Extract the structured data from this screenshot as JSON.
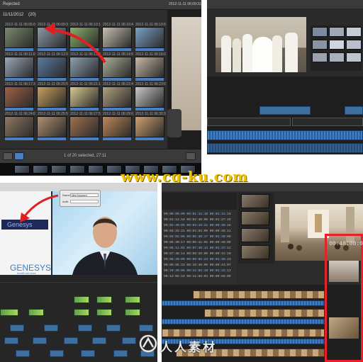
{
  "watermark": {
    "text": "www.cg-ku.com"
  },
  "logo_watermark": {
    "text": "人人素材"
  },
  "panel_a": {
    "header_left": "Rejected",
    "header_right": "2012-11-11 06:09:31",
    "event_label": "11/11/2012",
    "event_count": "(20)",
    "footer_text": "1 of 20 selected, 27:11",
    "thumb_labels": [
      "2012-11-11 06:05:0",
      "2012-11-11 06:09:3",
      "2012-11-11 06:10:1",
      "2012-11-11 06:10:4",
      "2012-11-11 06:10:5",
      "2012-11-11 06:11:0",
      "2012-11-11 06:12:0",
      "2012-11-11 06:13:2",
      "2012-11-11 06:14:5",
      "2012-11-11 06:16:0",
      "2012-11-11 06:17:3",
      "2012-11-11 06:20:5",
      "2012-11-11 06:21:1",
      "2012-11-11 06:22:4",
      "2012-11-11 06:23:0",
      "2012-11-11 06:24:0",
      "2012-11-11 06:25:5",
      "2012-11-11 06:27:5",
      "2012-11-11 06:29:0",
      "2012-11-11 06:30:3"
    ],
    "thumb_colors": [
      "#7a8a6a",
      "#8a9aa8",
      "#8ab06a",
      "#c8c0b0",
      "#7aa0c8",
      "#9aa8b8",
      "#5a7aa0",
      "#8aa0b0",
      "#a8b098",
      "#c8b8a8",
      "#a06048",
      "#c8a060",
      "#d8c890",
      "#b0a080",
      "#c8c8c8",
      "#907860",
      "#b09070",
      "#a07050",
      "#c08858",
      "#d0a070"
    ]
  },
  "panel_c": {
    "dialog_name_label": "Name:",
    "dialog_name_value": "New Keyword",
    "dialog_field2_label": "Auth:",
    "logo_top": "Genesys",
    "logo_bottom": "GENESYS",
    "logo_bottom_sub": "health services"
  },
  "panel_d": {
    "timecode": "00:48:00:00",
    "list_rows": [
      "00:00:00:00   00:01:12:10   00:01:12:10",
      "00:01:12:10   00:02:40:05   00:01:27:19",
      "00:02:40:05   00:03:15:21   00:00:35:16",
      "00:03:15:21   00:04:02:08   00:00:46:11",
      "00:04:02:08   00:05:30:17   00:01:28:09",
      "00:05:30:17   00:06:11:02   00:00:40:09",
      "00:06:11:02   00:07:48:14   00:01:37:12",
      "00:07:48:14   00:08:20:00   00:00:31:10",
      "00:08:20:00   00:09:55:23   00:01:35:23",
      "00:09:55:23   00:10:40:06   00:00:44:07",
      "00:10:40:06   00:12:02:19   00:01:22:13",
      "00:12:02:19   00:12:58:04   00:00:55:09"
    ]
  }
}
